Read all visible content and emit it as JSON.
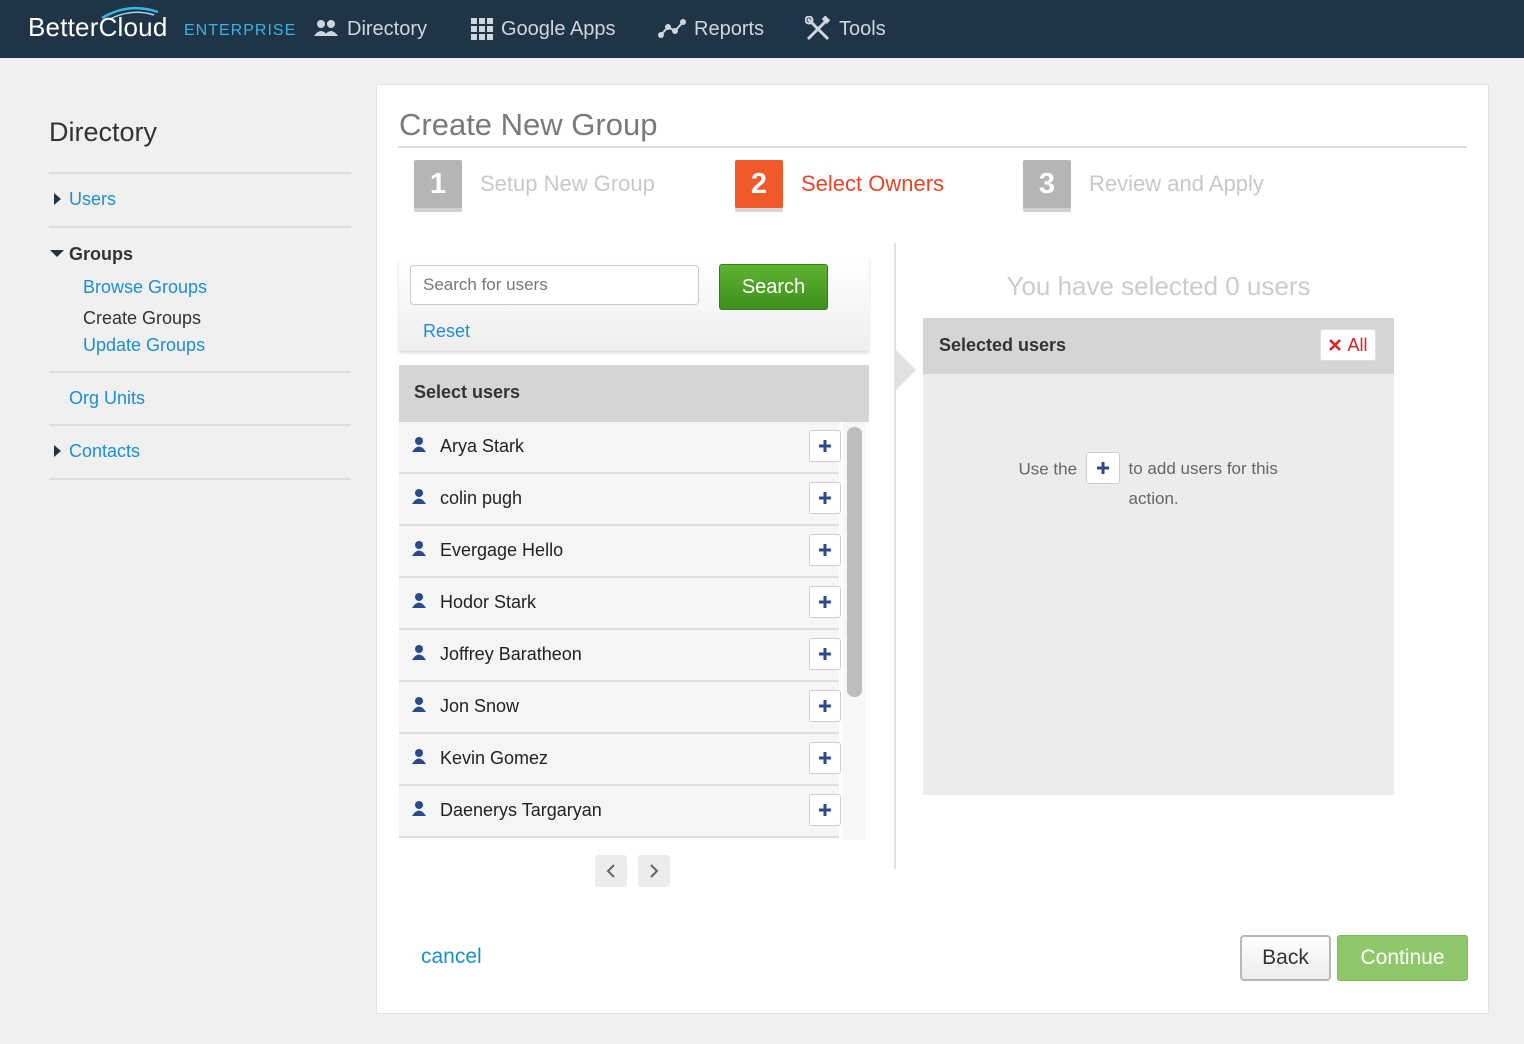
{
  "app": {
    "brand": "BetterCloud",
    "edition": "ENTERPRISE"
  },
  "nav": [
    {
      "label": "Directory",
      "icon": "users-icon"
    },
    {
      "label": "Google Apps",
      "icon": "grid-icon"
    },
    {
      "label": "Reports",
      "icon": "reports-icon"
    },
    {
      "label": "Tools",
      "icon": "tools-icon"
    }
  ],
  "sidebar": {
    "title": "Directory",
    "users": "Users",
    "groups": "Groups",
    "group_items": [
      "Browse Groups",
      "Create Groups",
      "Update Groups"
    ],
    "org_units": "Org Units",
    "contacts": "Contacts"
  },
  "page": {
    "title": "Create New Group"
  },
  "steps": [
    {
      "num": "1",
      "label": "Setup New Group",
      "active": false
    },
    {
      "num": "2",
      "label": "Select Owners",
      "active": true
    },
    {
      "num": "3",
      "label": "Review and Apply",
      "active": false
    }
  ],
  "search": {
    "placeholder": "Search for users",
    "value": "",
    "button": "Search",
    "reset": "Reset"
  },
  "select_users": {
    "header": "Select users",
    "users": [
      "Arya Stark",
      "colin pugh",
      "Evergage Hello",
      "Hodor Stark",
      "Joffrey Baratheon",
      "Jon Snow",
      "Kevin Gomez",
      "Daenerys Targaryan"
    ]
  },
  "selected": {
    "count_text": "You have selected 0 users",
    "header": "Selected users",
    "clear_all": "All",
    "hint_before": "Use the",
    "hint_after": "to add users for this action."
  },
  "footer": {
    "cancel": "cancel",
    "back": "Back",
    "continue": "Continue"
  },
  "colors": {
    "topbar": "#1f3446",
    "link": "#1b8fd1",
    "active_step": "#f05a2a",
    "search_button": "#4a9e24",
    "continue_button": "#8ec86a"
  }
}
